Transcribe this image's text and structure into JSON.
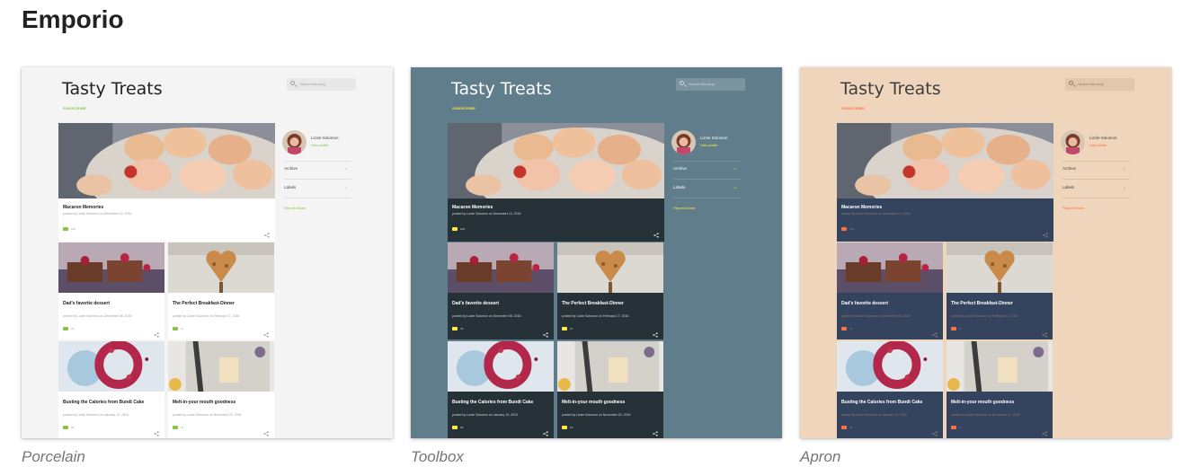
{
  "page_title": "Emporio",
  "blog": {
    "title": "Tasty Treats",
    "subscribe": "SUBSCRIBE",
    "search_placeholder": "Search this blog",
    "profile_name": "Lizzie Solomon",
    "visit_profile": "Visit profile",
    "archive": "Archive",
    "labels": "Labels",
    "report_abuse": "Report Abuse",
    "posts": [
      {
        "title": "Macaron Memories",
        "meta": "posted by Lizzie Solomon on December 12, 2016",
        "comments": "100"
      },
      {
        "title": "Dad's favorite dessert",
        "meta": "posted by Lizzie Solomon on December 08, 2016",
        "comments": "76"
      },
      {
        "title": "The Perfect Breakfast-Dinner",
        "meta": "posted by Lizzie Solomon on February 17, 2016",
        "comments": "27"
      },
      {
        "title": "Busting the Calories from Bundt Cake",
        "meta": "posted by Lizzie Solomon on January 13, 2016",
        "comments": "20"
      },
      {
        "title": "Melt-in-your mouth goodness",
        "meta": "posted by Lizzie Solomon on November 22, 2016",
        "comments": "12"
      }
    ]
  },
  "themes": [
    {
      "name": "Porcelain",
      "bg": "#f4f4f4",
      "title_color": "#212121",
      "accent": "#8bc34a",
      "text": "#424242",
      "muted": "#9e9e9e",
      "card": "#ffffff",
      "card_text": "#212121",
      "search_bg": "#e8e8e8",
      "rule": "#e0e0e0"
    },
    {
      "name": "Toolbox",
      "bg": "#607d8b",
      "title_color": "#ffffff",
      "accent": "#ffeb3b",
      "text": "#ffffff",
      "muted": "#cfd8dc",
      "card": "#263238",
      "card_text": "#ffffff",
      "search_bg": "#7b949f",
      "rule": "#78909c"
    },
    {
      "name": "Apron",
      "bg": "#efd5bc",
      "title_color": "#3e3e3e",
      "accent": "#ff7043",
      "text": "#3e3e3e",
      "muted": "#8d7b6e",
      "card": "#34445f",
      "card_text": "#ffffff",
      "search_bg": "#e2c7ae",
      "rule": "#d8bfa7"
    }
  ]
}
